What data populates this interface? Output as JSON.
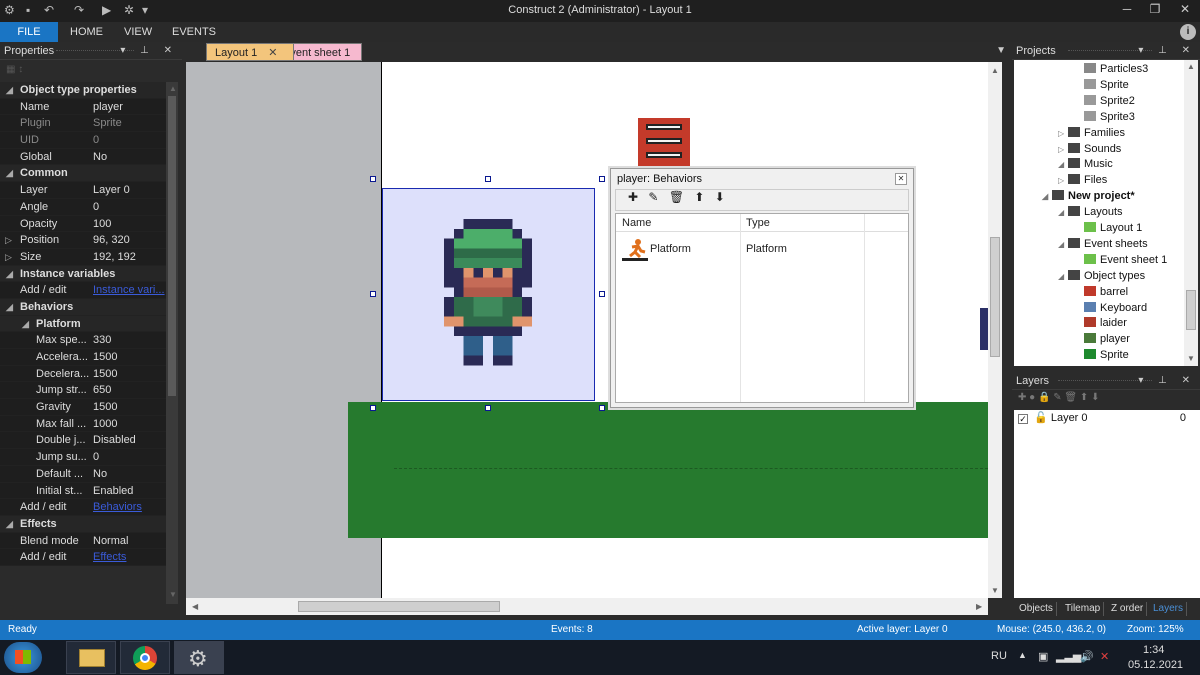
{
  "window": {
    "title": "Construct 2 (Administrator) - Layout 1"
  },
  "ribbon": {
    "tabs": [
      "FILE",
      "HOME",
      "VIEW",
      "EVENTS"
    ]
  },
  "properties": {
    "header": "Properties",
    "rows": [
      {
        "type": "cat",
        "label": "Object type properties"
      },
      {
        "type": "prop",
        "key": "Name",
        "value": "player"
      },
      {
        "type": "prop",
        "key": "Plugin",
        "value": "Sprite",
        "dim": true
      },
      {
        "type": "prop",
        "key": "UID",
        "value": "0",
        "dim": true
      },
      {
        "type": "prop",
        "key": "Global",
        "value": "No"
      },
      {
        "type": "cat",
        "label": "Common"
      },
      {
        "type": "prop",
        "key": "Layer",
        "value": "Layer 0"
      },
      {
        "type": "prop",
        "key": "Angle",
        "value": "0"
      },
      {
        "type": "prop",
        "key": "Opacity",
        "value": "100"
      },
      {
        "type": "prop",
        "key": "Position",
        "value": "96, 320",
        "expand": true
      },
      {
        "type": "prop",
        "key": "Size",
        "value": "192, 192",
        "expand": true
      },
      {
        "type": "cat",
        "label": "Instance variables"
      },
      {
        "type": "prop",
        "key": "Add / edit",
        "value": "Instance vari...",
        "link": true
      },
      {
        "type": "cat",
        "label": "Behaviors"
      },
      {
        "type": "sub",
        "label": "Platform"
      },
      {
        "type": "prop",
        "key": "Max spe...",
        "value": "330",
        "indent": true
      },
      {
        "type": "prop",
        "key": "Accelera...",
        "value": "1500",
        "indent": true
      },
      {
        "type": "prop",
        "key": "Decelera...",
        "value": "1500",
        "indent": true
      },
      {
        "type": "prop",
        "key": "Jump str...",
        "value": "650",
        "indent": true
      },
      {
        "type": "prop",
        "key": "Gravity",
        "value": "1500",
        "indent": true
      },
      {
        "type": "prop",
        "key": "Max fall ...",
        "value": "1000",
        "indent": true
      },
      {
        "type": "prop",
        "key": "Double j...",
        "value": "Disabled",
        "indent": true
      },
      {
        "type": "prop",
        "key": "Jump su...",
        "value": "0",
        "indent": true
      },
      {
        "type": "prop",
        "key": "Default ...",
        "value": "No",
        "indent": true
      },
      {
        "type": "prop",
        "key": "Initial st...",
        "value": "Enabled",
        "indent": true
      },
      {
        "type": "prop",
        "key": "Add / edit",
        "value": "Behaviors",
        "link": true
      },
      {
        "type": "cat",
        "label": "Effects"
      },
      {
        "type": "prop",
        "key": "Blend mode",
        "value": "Normal"
      },
      {
        "type": "prop",
        "key": "Add / edit",
        "value": "Effects",
        "link": true
      }
    ]
  },
  "doc_tabs": {
    "layout": "Layout 1",
    "event": "Event sheet 1"
  },
  "behaviors_dialog": {
    "title": "player: Behaviors",
    "col_name": "Name",
    "col_type": "Type",
    "rows": [
      {
        "name": "Platform",
        "type": "Platform"
      }
    ]
  },
  "projects": {
    "header": "Projects",
    "items": [
      {
        "label": "Particles3",
        "icon": "particles-icon",
        "level": 3
      },
      {
        "label": "Sprite",
        "icon": "sprite-icon",
        "level": 3
      },
      {
        "label": "Sprite2",
        "icon": "sprite-icon",
        "level": 3
      },
      {
        "label": "Sprite3",
        "icon": "sprite-icon",
        "level": 3
      },
      {
        "label": "Families",
        "icon": "folder-icon",
        "level": 2,
        "collapsed": true
      },
      {
        "label": "Sounds",
        "icon": "folder-icon",
        "level": 2,
        "collapsed": true
      },
      {
        "label": "Music",
        "icon": "folder-icon",
        "level": 2
      },
      {
        "label": "Files",
        "icon": "folder-icon",
        "level": 2,
        "collapsed": true
      },
      {
        "label": "New project*",
        "icon": "folder-open-icon",
        "level": 1,
        "bold": true
      },
      {
        "label": "Layouts",
        "icon": "folder-open-icon",
        "level": 2
      },
      {
        "label": "Layout 1",
        "icon": "layout-icon",
        "level": 3
      },
      {
        "label": "Event sheets",
        "icon": "folder-open-icon",
        "level": 2
      },
      {
        "label": "Event sheet 1",
        "icon": "eventsheet-icon",
        "level": 3
      },
      {
        "label": "Object types",
        "icon": "folder-open-icon",
        "level": 2
      },
      {
        "label": "barrel",
        "icon": "barrel-icon",
        "level": 3
      },
      {
        "label": "Keyboard",
        "icon": "keyboard-icon",
        "level": 3
      },
      {
        "label": "laider",
        "icon": "ladder-icon",
        "level": 3
      },
      {
        "label": "player",
        "icon": "player-icon",
        "level": 3
      },
      {
        "label": "Sprite",
        "icon": "green-sprite-icon",
        "level": 3
      }
    ]
  },
  "layers": {
    "header": "Layers",
    "items": [
      {
        "name": "Layer 0",
        "number": "0",
        "checked": true
      }
    ]
  },
  "bottom_tabs": [
    "Objects",
    "Tilemap",
    "Z order",
    "Layers"
  ],
  "status": {
    "ready": "Ready",
    "events": "Events: 8",
    "active_layer": "Active layer: Layer 0",
    "mouse": "Mouse: (245.0, 436.2, 0)",
    "zoom": "Zoom: 125%"
  },
  "taskbar": {
    "lang": "RU",
    "time": "1:34",
    "date": "05.12.2021"
  },
  "colors": {
    "accent": "#1a75c4",
    "ground": "#267a2e",
    "selection_fill": "#dde0fb"
  }
}
